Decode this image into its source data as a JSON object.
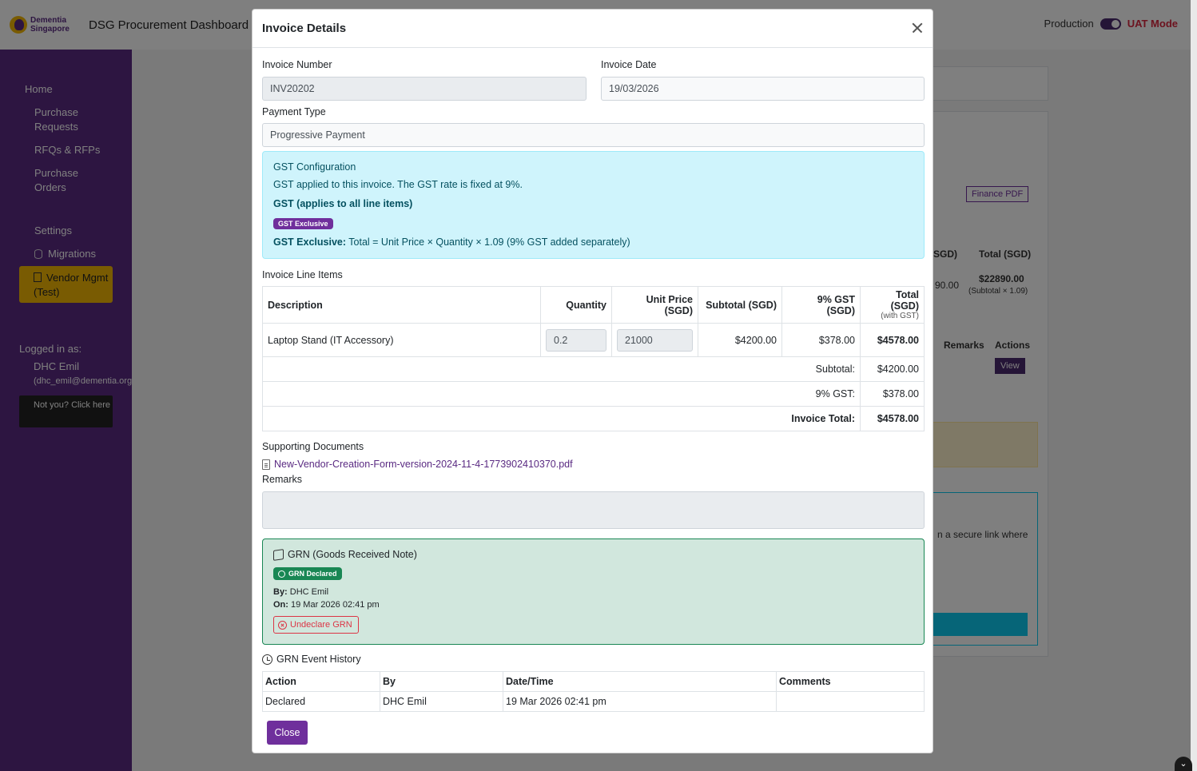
{
  "app": {
    "logo_line1": "Dementia",
    "logo_line2": "Singapore",
    "title": "DSG Procurement Dashboard",
    "env_production": "Production",
    "env_uat": "UAT Mode"
  },
  "sidebar": {
    "items": [
      "Home",
      "Purchase Requests",
      "RFQs & RFPs",
      "Purchase Orders",
      "Settings",
      "Migrations",
      "Vendor Mgmt (Test)"
    ],
    "logged_in_label": "Logged in as:",
    "user_name": "DHC Emil",
    "user_email": "(dhc_emil@dementia.org.",
    "not_you": "Not you? Click here"
  },
  "background": {
    "finance_pdf": "Finance PDF",
    "col_sgd": "SGD)",
    "col_total_sgd": "Total (SGD)",
    "val_partial": "90.00",
    "val_total": "$22890.00",
    "val_total_note": "(Subtotal × 1.09)",
    "col_remarks": "Remarks",
    "col_actions": "Actions",
    "view_button": "View",
    "secure_link_text": "n a secure link where"
  },
  "modal": {
    "title": "Invoice Details",
    "invoice_number_label": "Invoice Number",
    "invoice_number_value": "INV20202",
    "invoice_date_label": "Invoice Date",
    "invoice_date_value": "19/03/2026",
    "payment_type_label": "Payment Type",
    "payment_type_value": "Progressive Payment",
    "gst": {
      "heading": "GST Configuration",
      "note": "GST applied to this invoice. The GST rate is fixed at 9%.",
      "applies": "GST (applies to all line items)",
      "badge": "GST Exclusive",
      "formula_label": "GST Exclusive:",
      "formula": "Total = Unit Price × Quantity × 1.09 (9% GST added separately)"
    },
    "line_items_label": "Invoice Line Items",
    "table_headers": {
      "description": "Description",
      "quantity": "Quantity",
      "unit_price": "Unit Price (SGD)",
      "subtotal": "Subtotal (SGD)",
      "gst": "9% GST (SGD)",
      "total": "Total (SGD)",
      "total_note": "(with GST)"
    },
    "line_items": [
      {
        "description": "Laptop Stand (IT Accessory)",
        "quantity": "0.2",
        "unit_price": "21000",
        "subtotal": "$4200.00",
        "gst": "$378.00",
        "total": "$4578.00"
      }
    ],
    "summary": {
      "subtotal_label": "Subtotal:",
      "subtotal_value": "$4200.00",
      "gst_label": "9% GST:",
      "gst_value": "$378.00",
      "total_label": "Invoice Total:",
      "total_value": "$4578.00"
    },
    "supporting_docs_label": "Supporting Documents",
    "document_name": "New-Vendor-Creation-Form-version-2024-11-4-1773902410370.pdf",
    "remarks_label": "Remarks",
    "remarks_value": "",
    "grn": {
      "title": "GRN (Goods Received Note)",
      "badge": "GRN Declared",
      "by_label": "By:",
      "by_value": "DHC Emil",
      "on_label": "On:",
      "on_value": "19 Mar 2026 02:41 pm",
      "undeclare_label": "Undeclare GRN"
    },
    "history": {
      "title": "GRN Event History",
      "headers": [
        "Action",
        "By",
        "Date/Time",
        "Comments"
      ],
      "rows": [
        [
          "Declared",
          "DHC Emil",
          "19 Mar 2026 02:41 pm",
          ""
        ]
      ]
    },
    "close_label": "Close"
  },
  "colors": {
    "brand_purple": "#5a2a82",
    "button_purple": "#6f2f9c",
    "brand_yellow": "#f2b705",
    "uat_red": "#d9263f",
    "info_bg": "#cff4fc",
    "success_bg": "#d1e7dd",
    "success": "#198754",
    "danger": "#dc3545"
  }
}
